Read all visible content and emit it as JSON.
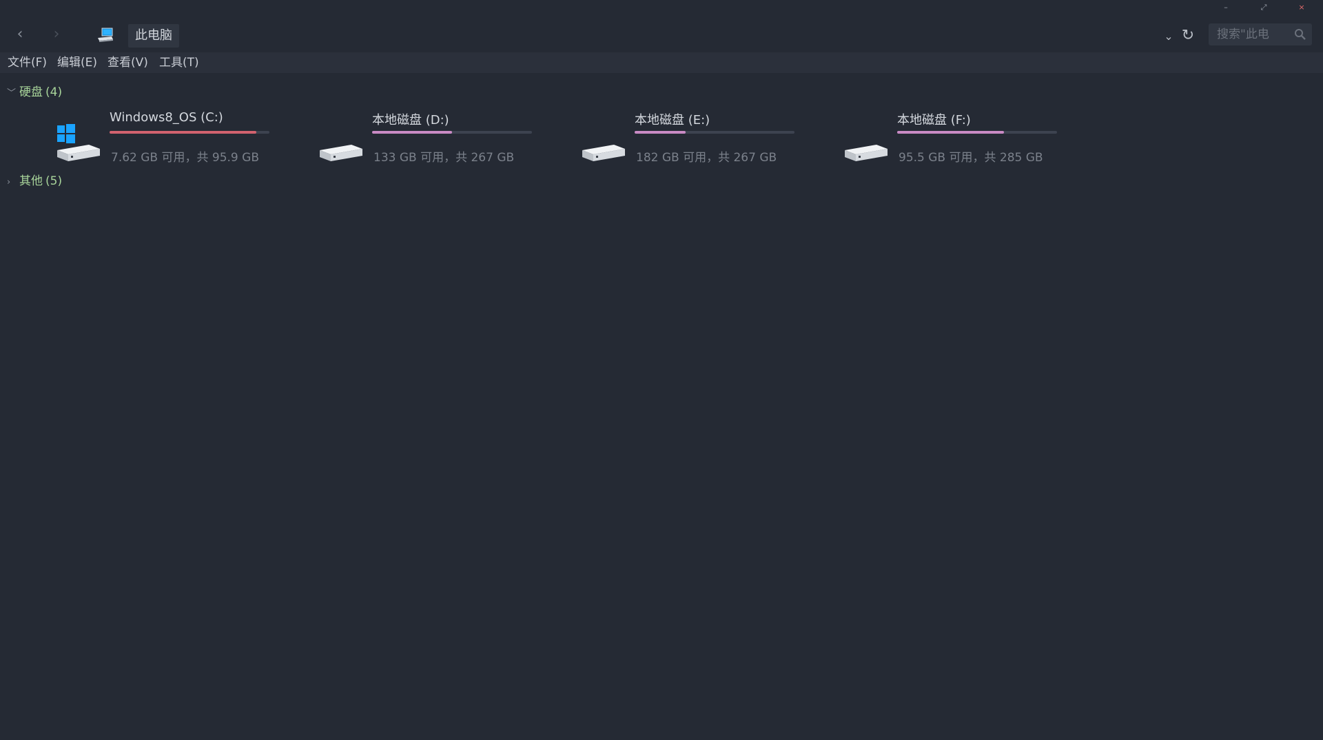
{
  "window": {
    "controls": {
      "minimize": "–",
      "restore": "⤢",
      "close": "×"
    }
  },
  "nav": {
    "back": "‹",
    "forward": "›"
  },
  "address": {
    "crumb": "此电脑",
    "dropdown": "⌄",
    "refresh": "↻"
  },
  "search": {
    "placeholder": "搜索\"此电"
  },
  "menu": {
    "file": "文件(F)",
    "edit": "编辑(E)",
    "view": "查看(V)",
    "tools": "工具(T)"
  },
  "groups": {
    "hard_disks": {
      "chevron": "﹀",
      "label": "硬盘",
      "count": "(4)"
    },
    "other": {
      "chevron": "›",
      "label": "其他",
      "count": "(5)"
    }
  },
  "drives": [
    {
      "name": "Windows8_OS (C:)",
      "info": "7.62 GB 可用，共 95.9 GB",
      "used_fraction": 0.92,
      "bar_color": "#d2626e",
      "icon": "windows-system-drive-icon"
    },
    {
      "name": "本地磁盘 (D:)",
      "info": "133 GB 可用，共 267 GB",
      "used_fraction": 0.5,
      "bar_color": "#c98ac4",
      "icon": "hard-drive-icon"
    },
    {
      "name": "本地磁盘 (E:)",
      "info": "182 GB 可用，共 267 GB",
      "used_fraction": 0.32,
      "bar_color": "#c98ac4",
      "icon": "hard-drive-icon"
    },
    {
      "name": "本地磁盘 (F:)",
      "info": "95.5 GB 可用，共 285 GB",
      "used_fraction": 0.67,
      "bar_color": "#c98ac4",
      "icon": "hard-drive-icon"
    }
  ]
}
